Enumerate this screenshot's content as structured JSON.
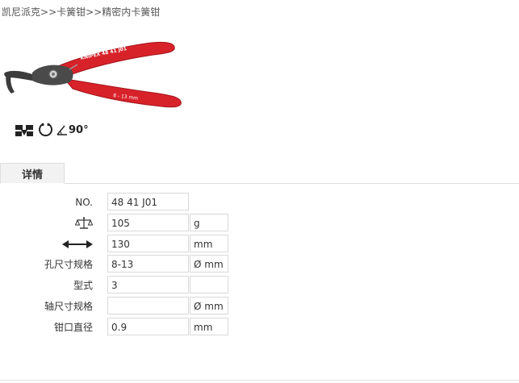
{
  "breadcrumb": {
    "items": [
      "凯尼派克",
      "卡簧钳",
      "精密内卡簧钳"
    ],
    "separator": ">>"
  },
  "features": {
    "angle_text": "90°"
  },
  "tabs": [
    {
      "label": "详情"
    }
  ],
  "specs": {
    "no": {
      "label": "NO.",
      "value": "48 41 J01"
    },
    "weight": {
      "icon": "scale-icon",
      "value": "105",
      "unit": "g"
    },
    "length": {
      "icon": "length-arrow-icon",
      "value": "130",
      "unit": "mm"
    },
    "bore": {
      "label": "孔尺寸规格",
      "value": "8-13",
      "unit": "Ø mm"
    },
    "type": {
      "label": "型式",
      "value": "3",
      "unit": ""
    },
    "shaft": {
      "label": "轴尺寸规格",
      "value": "",
      "unit": "Ø mm"
    },
    "tip": {
      "label": "钳口直径",
      "value": "0.9",
      "unit": "mm"
    }
  },
  "product_image": {
    "handle_text": "KNIPEX  48 41 J01",
    "range_text": "8 - 13 mm"
  },
  "colors": {
    "handle_red": "#d8222a",
    "metal_dark": "#4a4a4a"
  }
}
